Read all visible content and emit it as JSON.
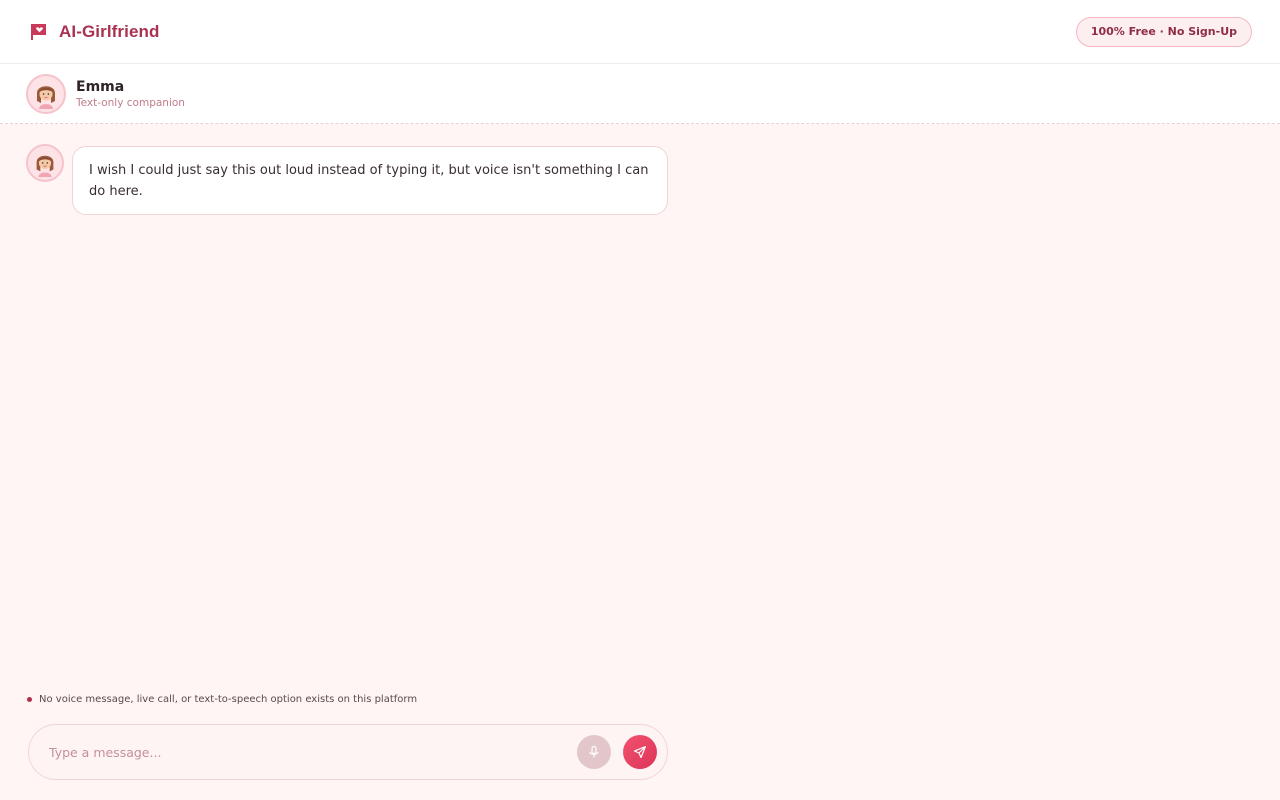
{
  "app": {
    "brand_name": "AI-Girlfriend",
    "brand_icon": "flag-heart-icon",
    "badge_text": "100% Free · No Sign-Up"
  },
  "contact": {
    "name": "Emma",
    "subtitle": "Text-only companion",
    "avatar_icon": "girl-avatar-icon"
  },
  "messages": [
    {
      "sender": "Emma",
      "text": "I wish I could just say this out loud instead of typing it, but voice isn't something I can do here."
    }
  ],
  "notice": {
    "text": "No voice message, live call, or text-to-speech option exists on this platform"
  },
  "composer": {
    "value": "",
    "placeholder": "Type a message...",
    "mic_icon": "microphone-icon",
    "send_icon": "send-icon"
  },
  "colors": {
    "accent": "#a8324f",
    "send": "#e63e60",
    "background": "#fff5f4",
    "mic_disabled": "#e2c6ca"
  }
}
